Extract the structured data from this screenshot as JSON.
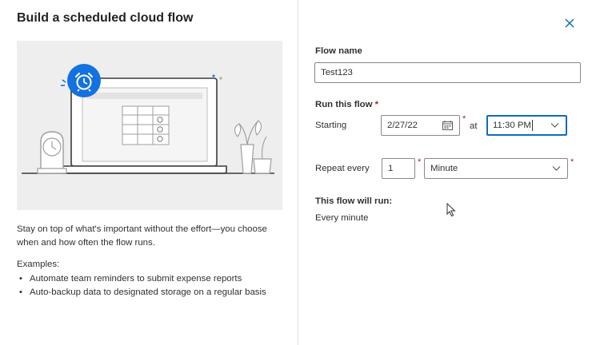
{
  "dialog": {
    "title": "Build a scheduled cloud flow",
    "close_icon": "close-icon"
  },
  "left": {
    "description": "Stay on top of what's important without the effort—you choose when and how often the flow runs.",
    "examples_heading": "Examples:",
    "examples": [
      "Automate team reminders to submit expense reports",
      "Auto-backup data to designated storage on a regular basis"
    ]
  },
  "form": {
    "flow_name_label": "Flow name",
    "flow_name_value": "Test123",
    "run_label": "Run this flow",
    "required_mark": "*",
    "starting_label": "Starting",
    "date_value": "2/27/22",
    "at_label": "at",
    "time_value": "11:30 PM",
    "repeat_label": "Repeat every",
    "interval_value": "1",
    "unit_value": "Minute",
    "summary_heading": "This flow will run:",
    "summary_text": "Every minute"
  },
  "colors": {
    "accent": "#0f6cbd",
    "required": "#a4262c",
    "badge": "#1472e0"
  }
}
